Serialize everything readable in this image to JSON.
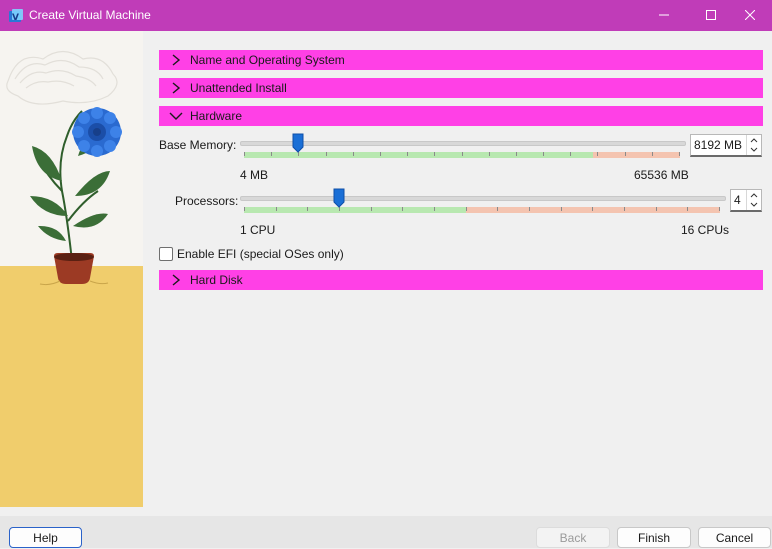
{
  "window": {
    "title": "Create Virtual Machine"
  },
  "sections": {
    "name_os": {
      "label": "Name and Operating System",
      "expanded": false
    },
    "unattended": {
      "label": "Unattended Install",
      "expanded": false
    },
    "hardware": {
      "label": "Hardware",
      "expanded": true
    },
    "hard_disk": {
      "label": "Hard Disk",
      "expanded": false
    }
  },
  "hardware": {
    "base_memory": {
      "label": "Base Memory:",
      "value": "8192 MB",
      "min_label": "4 MB",
      "max_label": "65536 MB",
      "value_mb": 8192,
      "min_mb": 4,
      "max_mb": 65536,
      "recommended_max_fraction": 0.8
    },
    "processors": {
      "label": "Processors:",
      "value": "4",
      "min_label": "1 CPU",
      "max_label": "16 CPUs",
      "value_count": 4,
      "min_count": 1,
      "max_count": 16,
      "recommended_max_count": 8
    },
    "efi": {
      "label": "Enable EFI (special OSes only)",
      "checked": false
    }
  },
  "buttons": {
    "help": "Help",
    "back": "Back",
    "finish": "Finish",
    "cancel": "Cancel"
  },
  "colors": {
    "titlebar": "#c03cb8",
    "section_header": "#ff40e6",
    "slider_ok": "#b8e8b0",
    "slider_warn": "#f4c4b0",
    "thumb": "#1a6fd6"
  },
  "icons": {
    "app": "virtualbox-icon",
    "minimize": "minimize-icon",
    "maximize": "maximize-icon",
    "close": "close-icon",
    "chevron_right": "chevron-right-icon",
    "chevron_down": "chevron-down-icon"
  }
}
